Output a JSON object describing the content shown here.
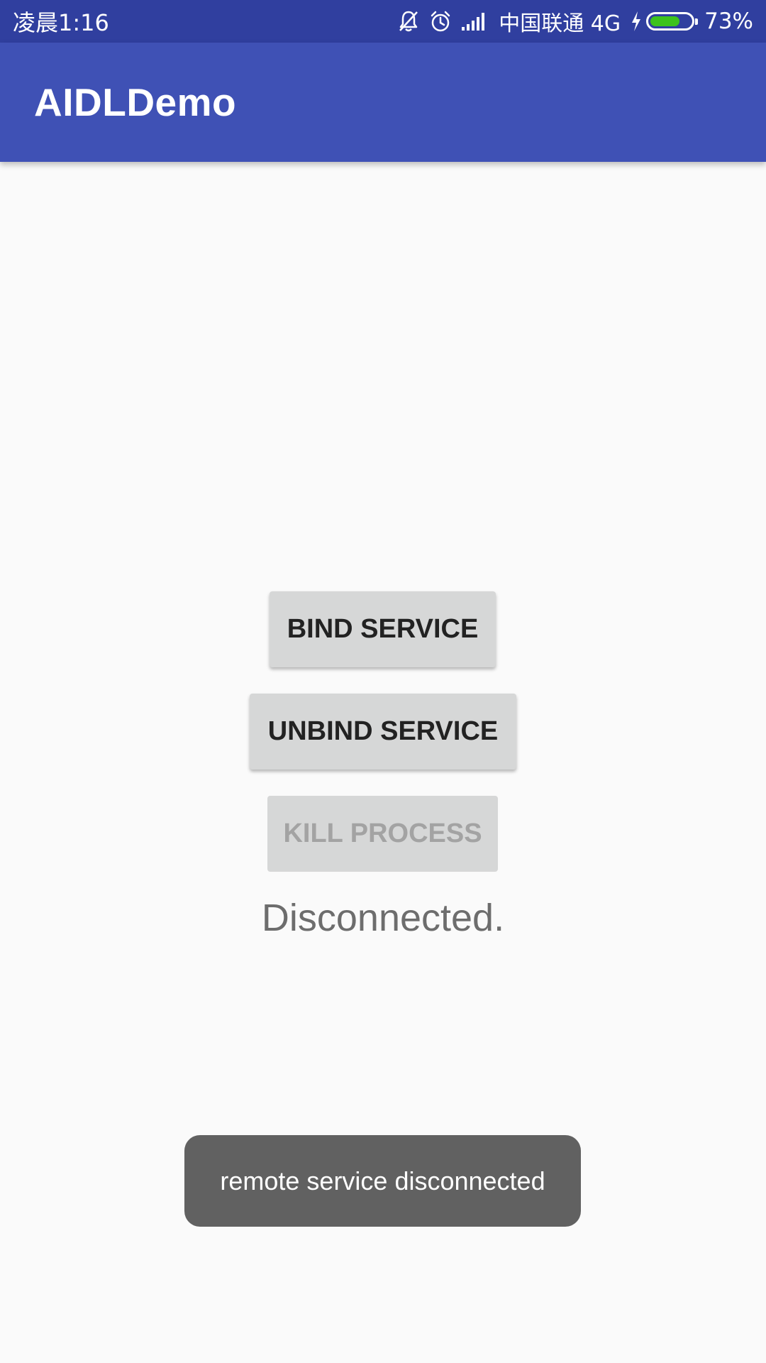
{
  "status_bar": {
    "time": "凌晨1:16",
    "carrier": "中国联通 4G",
    "battery_percent_label": "73%",
    "battery_level": 0.73,
    "icons": [
      "bell-off-icon",
      "alarm-icon",
      "signal-icon",
      "charging-bolt-icon",
      "battery-icon"
    ],
    "background_color": "#303f9f"
  },
  "app_bar": {
    "title": "AIDLDemo",
    "background_color": "#3f51b5"
  },
  "main": {
    "bind_button": "BIND SERVICE",
    "unbind_button": "UNBIND SERVICE",
    "kill_button": "KILL PROCESS",
    "kill_button_enabled": false,
    "connection_status": "Disconnected."
  },
  "toast": {
    "message": "remote service disconnected"
  }
}
